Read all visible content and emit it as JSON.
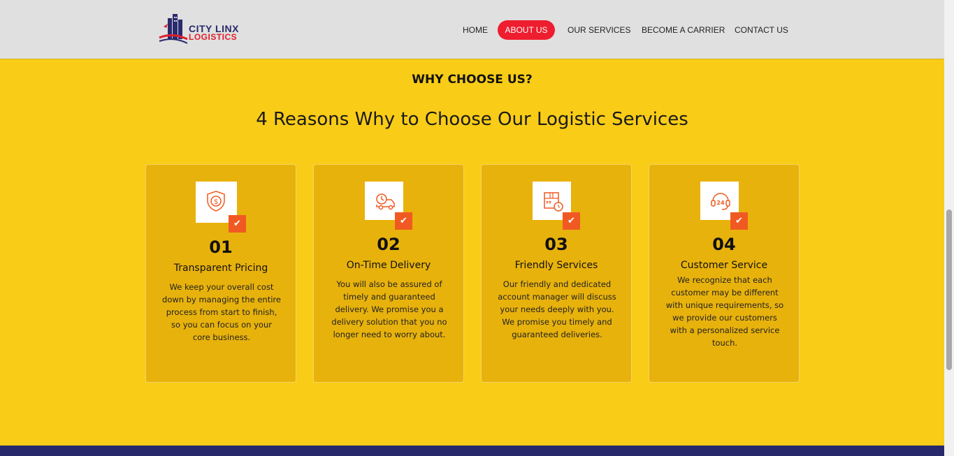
{
  "brand": {
    "line1": "CITY LINX",
    "line2": "LOGISTICS",
    "accent": "#ee1d2f",
    "navy": "#2a2a6e"
  },
  "nav": {
    "home": "HOME",
    "about": "ABOUT US",
    "services": "OUR SERVICES",
    "carrier": "BECOME A CARRIER",
    "contact": "CONTACT US"
  },
  "section": {
    "eyebrow": "WHY CHOOSE US?",
    "headline": "4 Reasons Why to Choose Our Logistic Services"
  },
  "cards": [
    {
      "icon": "dollar-shield-icon",
      "number": "01",
      "title": "Transparent Pricing",
      "description": "We keep your overall cost down by managing the entire process from start to finish, so you can focus on your core business."
    },
    {
      "icon": "delivery-truck-clock-icon",
      "number": "02",
      "title": "On-Time Delivery",
      "description": "You will also be assured of timely and guaranteed delivery. We promise you a delivery solution that you no longer need to worry about."
    },
    {
      "icon": "package-clock-icon",
      "number": "03",
      "title": "Friendly Services",
      "description": "Our friendly and dedicated account manager will discuss your needs deeply with you. We promise you timely and guaranteed deliveries."
    },
    {
      "icon": "headset-24-icon",
      "number": "04",
      "title": "Customer Service",
      "description": "We recognize that each customer may be different with unique requirements, so we provide our customers with a personalized service touch."
    }
  ],
  "colors": {
    "background": "#f9cc17",
    "card": "#e8b20c",
    "check": "#f05a22",
    "footer": "#27286b"
  }
}
